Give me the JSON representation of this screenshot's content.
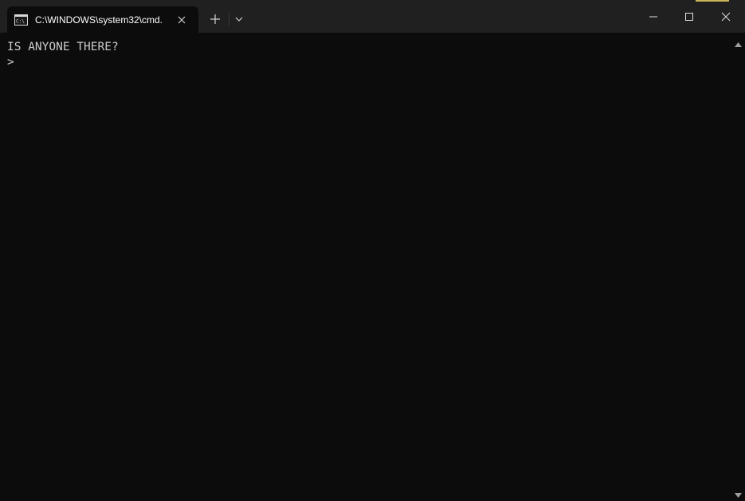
{
  "tab": {
    "title": "C:\\WINDOWS\\system32\\cmd.",
    "icon": "cmd-prompt-icon"
  },
  "toolbar": {
    "new_tab_icon": "plus-icon",
    "dropdown_icon": "chevron-down-icon"
  },
  "window_controls": {
    "minimize_icon": "minimize-icon",
    "maximize_icon": "maximize-icon",
    "close_icon": "close-icon"
  },
  "terminal": {
    "lines": [
      "IS ANYONE THERE?",
      ">"
    ]
  },
  "colors": {
    "background": "#0c0c0c",
    "titlebar": "#202020",
    "text": "#cccccc"
  }
}
